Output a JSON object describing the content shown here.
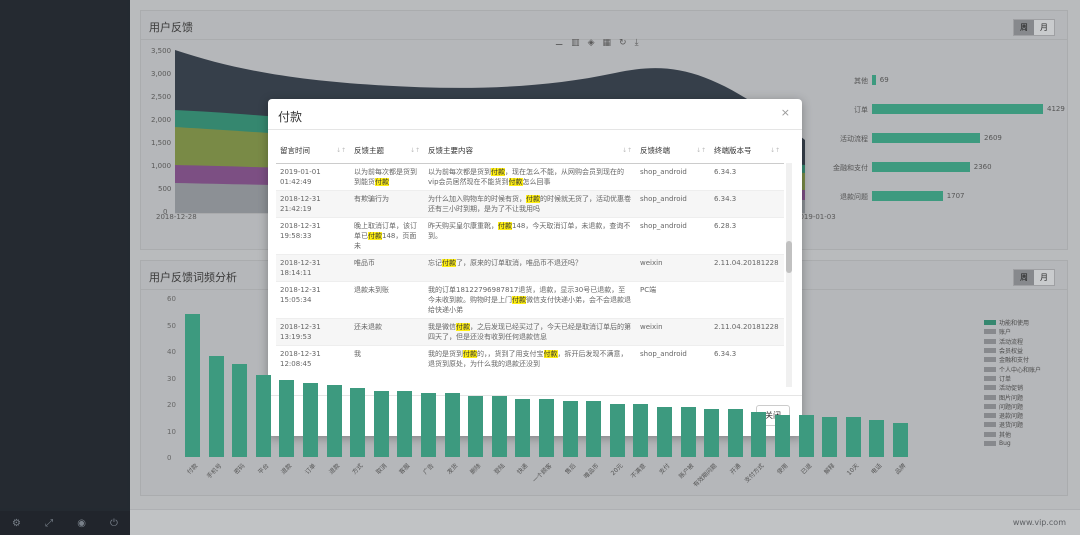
{
  "sidebar": {
    "footer_icons": [
      "gear-icon",
      "expand-icon",
      "eye-icon",
      "power-icon"
    ]
  },
  "footer": {
    "text": "www.vip.com"
  },
  "feedback_panel": {
    "title": "用户反馈",
    "toggle": [
      "周",
      "月"
    ],
    "y_ticks": [
      "3,500",
      "3,000",
      "2,500",
      "2,000",
      "1,500",
      "1,000",
      "500",
      "0"
    ],
    "x_first_date": "2018-12-28",
    "x_last_date": "2019-01-03",
    "bars": [
      {
        "label": "其他",
        "value": "69"
      },
      {
        "label": "订单",
        "value": "4129"
      },
      {
        "label": "活动流程",
        "value": "2609"
      },
      {
        "label": "金融和支付",
        "value": "2360"
      },
      {
        "label": "退款问题",
        "value": "1707"
      }
    ]
  },
  "word_panel": {
    "title": "用户反馈词频分析",
    "toggle": [
      "周",
      "月"
    ],
    "y_ticks": [
      "60",
      "50",
      "40",
      "30",
      "20",
      "10",
      "0"
    ],
    "bars": [
      {
        "label": "付款",
        "value": 54
      },
      {
        "label": "手机号",
        "value": 38
      },
      {
        "label": "密码",
        "value": 35
      },
      {
        "label": "平台",
        "value": 31
      },
      {
        "label": "退款",
        "value": 29
      },
      {
        "label": "订单",
        "value": 28
      },
      {
        "label": "退款",
        "value": 27
      },
      {
        "label": "方式",
        "value": 26
      },
      {
        "label": "取消",
        "value": 25
      },
      {
        "label": "客服",
        "value": 25
      },
      {
        "label": "广告",
        "value": 24
      },
      {
        "label": "发货",
        "value": 24
      },
      {
        "label": "删除",
        "value": 23
      },
      {
        "label": "登陆",
        "value": 23
      },
      {
        "label": "快递",
        "value": 22
      },
      {
        "label": "一个顾客",
        "value": 22
      },
      {
        "label": "售后",
        "value": 21
      },
      {
        "label": "唯品币",
        "value": 21
      },
      {
        "label": "20元",
        "value": 20
      },
      {
        "label": "不满意",
        "value": 20
      },
      {
        "label": "支付",
        "value": 19
      },
      {
        "label": "账户被",
        "value": 19
      },
      {
        "label": "有效期问题",
        "value": 18
      },
      {
        "label": "开通",
        "value": 18
      },
      {
        "label": "支付方式",
        "value": 17
      },
      {
        "label": "使用",
        "value": 16
      },
      {
        "label": "已退",
        "value": 16
      },
      {
        "label": "解释",
        "value": 15
      },
      {
        "label": "10天",
        "value": 15
      },
      {
        "label": "电话",
        "value": 14
      },
      {
        "label": "品牌",
        "value": 13
      }
    ],
    "legend": [
      "功能和使用",
      "账户",
      "活动流程",
      "会员权益",
      "金融和支付",
      "个人中心和账户",
      "订单",
      "活动促销",
      "图片问题",
      "问题问题",
      "退款问题",
      "退货问题",
      "其他",
      "Bug"
    ],
    "legend_colors": [
      "#3d9a7f",
      "#9a9da1",
      "#9a9da1",
      "#9a9da1",
      "#9a9da1",
      "#9a9da1",
      "#9a9da1",
      "#9a9da1",
      "#9a9da1",
      "#9a9da1",
      "#9a9da1",
      "#9a9da1",
      "#9a9da1",
      "#9a9da1"
    ]
  },
  "modal": {
    "title": "付款",
    "close_label": "×",
    "close_button": "关闭",
    "highlight": "付款",
    "columns": [
      "留言时间",
      "反馈主题",
      "反馈主要内容",
      "反馈终端",
      "终端版本号"
    ],
    "rows": [
      {
        "time": "2019-01-01 01:42:49",
        "topic": "以为前每次都是货到到能货付款",
        "content": "以为前每次都是货到付款，现在怎么不能，从网购会员到现在的vip会员居然现在不能货到付款怎么回事",
        "terminal": "shop_android",
        "version": "6.34.3"
      },
      {
        "time": "2018-12-31 21:42:19",
        "topic": "有欺骗行为",
        "content": "为什么加入购物车的时候有货，付款的时候就无货了，活动优惠卷还有三小时到期，是为了不让我用吗",
        "terminal": "shop_android",
        "version": "6.34.3"
      },
      {
        "time": "2018-12-31 19:58:33",
        "topic": "晚上取消订单，该订单已付款148，页面未",
        "content": "昨天购买皇尔康重靴，付款148，今天取消订单，未退款，查询不到。",
        "terminal": "shop_android",
        "version": "6.28.3"
      },
      {
        "time": "2018-12-31 18:14:11",
        "topic": "唯品币",
        "content": "忘记付款了，原来的订单取消，唯品币不退还吗？",
        "terminal": "weixin",
        "version": "2.11.04.20181228"
      },
      {
        "time": "2018-12-31 15:05:34",
        "topic": "退款未到账",
        "content": "我的订单18122796987817退货，退款，显示30号已退款，至今未收到款。购物时是上门付款微信支付快递小弟，会不会退款退给快递小弟",
        "terminal": "PC端",
        "version": ""
      },
      {
        "time": "2018-12-31 13:19:53",
        "topic": "还未退款",
        "content": "我是微信付款，之后发现已经买过了，今天已经是取消订单后的第四天了，但是还没有收到任何退款信息",
        "terminal": "weixin",
        "version": "2.11.04.20181228"
      },
      {
        "time": "2018-12-31 12:08:45",
        "topic": "我",
        "content": "我的是货到付款的，，货到了用支付宝付款，拆开后发现不满意，退货到原处，为什么我的退款还没到",
        "terminal": "shop_android",
        "version": "6.34.3"
      }
    ]
  }
}
